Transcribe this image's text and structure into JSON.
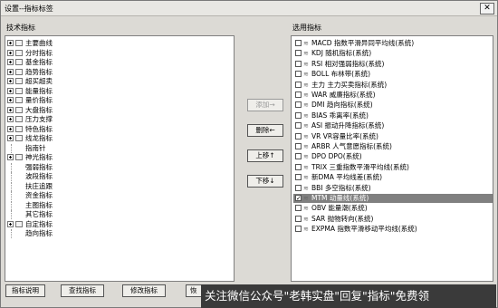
{
  "window": {
    "title": "设置--指标标签",
    "close_label": "✕"
  },
  "left": {
    "header": "技术指标",
    "tree": [
      {
        "label": "主要曲线",
        "type": "folder"
      },
      {
        "label": "分时指标",
        "type": "folder"
      },
      {
        "label": "基金指标",
        "type": "folder"
      },
      {
        "label": "趋势指标",
        "type": "folder"
      },
      {
        "label": "超买超卖",
        "type": "folder"
      },
      {
        "label": "能量指标",
        "type": "folder"
      },
      {
        "label": "量价指标",
        "type": "folder"
      },
      {
        "label": "大盘指标",
        "type": "folder"
      },
      {
        "label": "压力支撑",
        "type": "folder"
      },
      {
        "label": "特色指标",
        "type": "folder"
      },
      {
        "label": "线龙指标",
        "type": "folder"
      },
      {
        "label": "指南针",
        "type": "leaf"
      },
      {
        "label": "神光指标",
        "type": "folder"
      },
      {
        "label": "强弱指标",
        "type": "leaf"
      },
      {
        "label": "波段指标",
        "type": "leaf"
      },
      {
        "label": "扶庄追跟",
        "type": "leaf"
      },
      {
        "label": "资金指标",
        "type": "leaf"
      },
      {
        "label": "主图指标",
        "type": "leaf"
      },
      {
        "label": "其它指标",
        "type": "leaf"
      },
      {
        "label": "自定指标",
        "type": "folder"
      },
      {
        "label": "趋向指标",
        "type": "leaf"
      }
    ]
  },
  "right": {
    "header": "选用指标",
    "items": [
      {
        "label": "MACD 指数平滑异同平均线(系统)",
        "checked": false
      },
      {
        "label": "KDJ 随机指标(系统)",
        "checked": false
      },
      {
        "label": "RSI 相对强弱指标(系统)",
        "checked": false
      },
      {
        "label": "BOLL 布林带(系统)",
        "checked": false
      },
      {
        "label": "主力 主力买卖指标(系统)",
        "checked": false
      },
      {
        "label": "WAR 威廉指标(系统)",
        "checked": false
      },
      {
        "label": "DMI 趋向指标(系统)",
        "checked": false
      },
      {
        "label": "BIAS 乖离率(系统)",
        "checked": false
      },
      {
        "label": "ASI 振动升降指标(系统)",
        "checked": false
      },
      {
        "label": "VR VR容量比率(系统)",
        "checked": false
      },
      {
        "label": "ARBR 人气意愿指标(系统)",
        "checked": false
      },
      {
        "label": "DPO DPO(系统)",
        "checked": false
      },
      {
        "label": "TRIX 三重指数平滑平均线(系统)",
        "checked": false
      },
      {
        "label": "新DMA 平均线差(系统)",
        "checked": false
      },
      {
        "label": "BBI 多空指标(系统)",
        "checked": false
      },
      {
        "label": "MTM 动量线(系统)",
        "checked": true,
        "selected": true
      },
      {
        "label": "OBV 能量潮(系统)",
        "checked": false
      },
      {
        "label": "SAR 抛物转向(系统)",
        "checked": false
      },
      {
        "label": "EXPMA 指数平滑移动平均线(系统)",
        "checked": false
      }
    ]
  },
  "buttons": {
    "add": "添加→",
    "remove": "删除←",
    "up": "上移↑",
    "down": "下移↓",
    "help": "指标说明",
    "find": "查找指标",
    "edit": "修改指标",
    "partial": "恢"
  },
  "watermark": "关注微信公众号\"老韩实盘\"回复\"指标\"免费领"
}
